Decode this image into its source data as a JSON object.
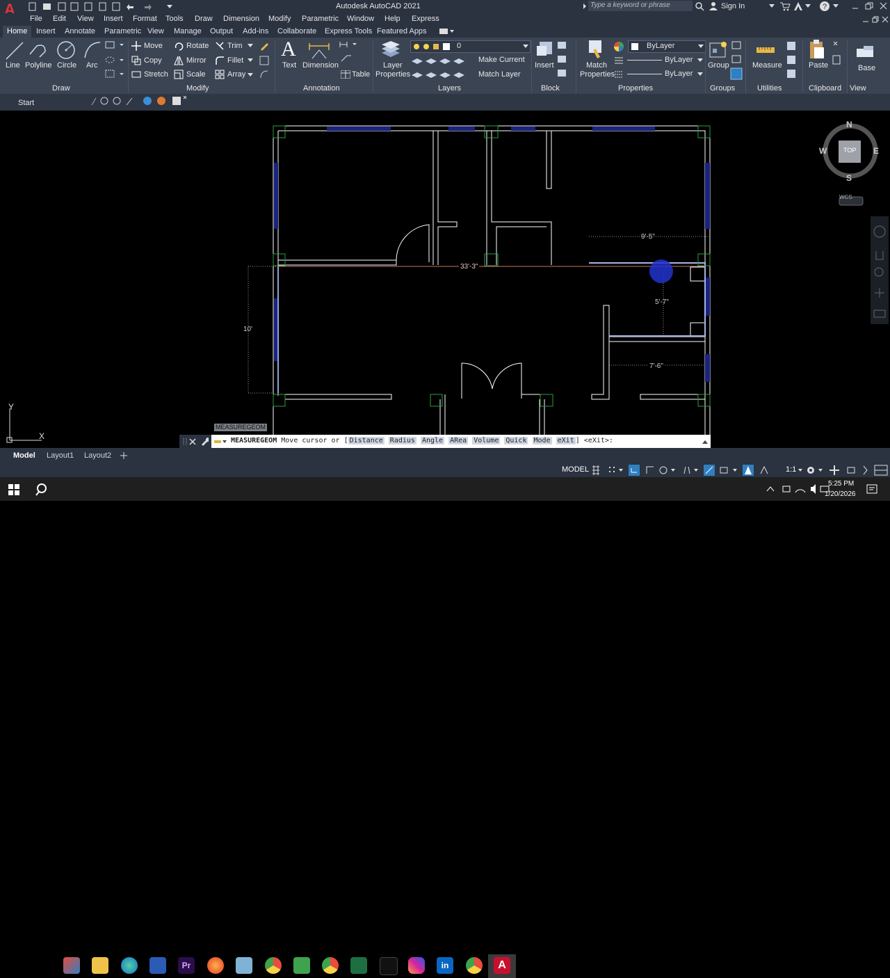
{
  "app": {
    "title": "Autodesk AutoCAD 2021",
    "logo_letter": "A",
    "search_placeholder": "Type a keyword or phrase",
    "sign_in": "Sign In"
  },
  "menu": [
    "File",
    "Edit",
    "View",
    "Insert",
    "Format",
    "Tools",
    "Draw",
    "Dimension",
    "Modify",
    "Parametric",
    "Window",
    "Help",
    "Express"
  ],
  "ribbon_tabs": [
    "Home",
    "Insert",
    "Annotate",
    "Parametric",
    "View",
    "Manage",
    "Output",
    "Add-ins",
    "Collaborate",
    "Express Tools",
    "Featured Apps"
  ],
  "ribbon": {
    "draw": {
      "line": "Line",
      "polyline": "Polyline",
      "circle": "Circle",
      "arc": "Arc",
      "panel": "Draw"
    },
    "modify": {
      "move": "Move",
      "rotate": "Rotate",
      "trim": "Trim",
      "copy": "Copy",
      "mirror": "Mirror",
      "fillet": "Fillet",
      "stretch": "Stretch",
      "scale": "Scale",
      "array": "Array",
      "panel": "Modify"
    },
    "annotation": {
      "text": "Text",
      "dimension": "Dimension",
      "table": "Table",
      "panel": "Annotation"
    },
    "layers": {
      "layer_properties_1": "Layer",
      "layer_properties_2": "Properties",
      "current_layer": "0",
      "make_current": "Make Current",
      "match_layer": "Match Layer",
      "panel": "Layers"
    },
    "block": {
      "insert": "Insert",
      "panel": "Block"
    },
    "properties": {
      "match_1": "Match",
      "match_2": "Properties",
      "color": "ByLayer",
      "linetype": "ByLayer",
      "lineweight": "ByLayer",
      "panel": "Properties"
    },
    "groups": {
      "group": "Group",
      "panel": "Groups"
    },
    "utilities": {
      "measure": "Measure",
      "panel": "Utilities"
    },
    "clipboard": {
      "paste": "Paste",
      "panel": "Clipboard"
    },
    "view": {
      "base": "Base",
      "panel": "View"
    }
  },
  "file_tab": "Start",
  "viewcube": {
    "n": "N",
    "s": "S",
    "e": "E",
    "w": "W",
    "top": "TOP",
    "wcs": "WCS"
  },
  "drawing": {
    "dim_top": "33'-3\"",
    "dim_right_top": "9'-5\"",
    "dim_right_mid": "5'-7\"",
    "dim_right_low": "7'-6\"",
    "dim_left": "10'"
  },
  "ucs": {
    "x": "X",
    "y": "Y"
  },
  "tooltip": "MEASUREGEOM",
  "command": {
    "name": "MEASUREGEOM",
    "prompt": "Move cursor or [",
    "options": [
      "Distance",
      "Radius",
      "Angle",
      "ARea",
      "Volume",
      "Quick",
      "Mode",
      "eXit"
    ],
    "tail": "] <eXit>:"
  },
  "layout_tabs": [
    "Model",
    "Layout1",
    "Layout2"
  ],
  "status": {
    "model": "MODEL",
    "scale": "1:1"
  },
  "taskbar": {
    "time": "5:25 PM",
    "date": "1/20/2026"
  },
  "colors": {
    "accent": "#2f7fc1",
    "wall": "#ffffff",
    "window": "#1a237e",
    "column": "#2e7d32",
    "autocad_red": "#c8102e"
  }
}
